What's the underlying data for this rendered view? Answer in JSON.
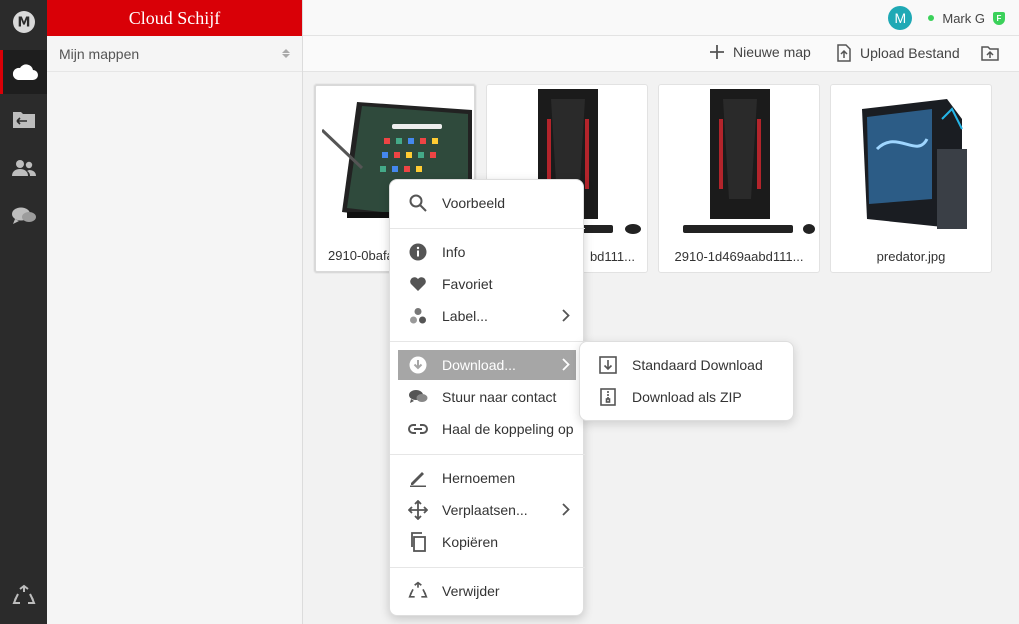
{
  "app": {
    "title": "Cloud Schijf",
    "logo_letter": "M"
  },
  "rail": {
    "icons": [
      "mega-logo-icon",
      "cloud-drive-icon",
      "inbox-folder-icon",
      "contacts-icon",
      "chat-icon",
      "rubbish-bin-icon"
    ]
  },
  "sidebar": {
    "folder_header": "Mijn mappen"
  },
  "topbar": {
    "avatar_letter": "M",
    "user_name": "Mark G",
    "badge": "F",
    "accent": "#d90007",
    "avatar_color": "#1fa9b5",
    "online_color": "#3bd15a"
  },
  "toolbar": {
    "new_folder": "Nieuwe map",
    "upload_file": "Upload Bestand"
  },
  "files": [
    {
      "name": "2910-0bafa",
      "selected": true
    },
    {
      "name": "2910-1d469aabd111..."
    },
    {
      "name": "2910-1d469aabd111..."
    },
    {
      "name": "predator.jpg"
    }
  ],
  "context_menu": {
    "preview": "Voorbeeld",
    "info": "Info",
    "favourite": "Favoriet",
    "label": "Label...",
    "download": "Download...",
    "send_to_contact": "Stuur naar contact",
    "get_link": "Haal de koppeling op",
    "rename": "Hernoemen",
    "move": "Verplaatsen...",
    "copy": "Kopiëren",
    "delete": "Verwijder"
  },
  "download_submenu": {
    "standard": "Standaard Download",
    "zip": "Download als ZIP"
  },
  "tile1_suffix": "bd111..."
}
